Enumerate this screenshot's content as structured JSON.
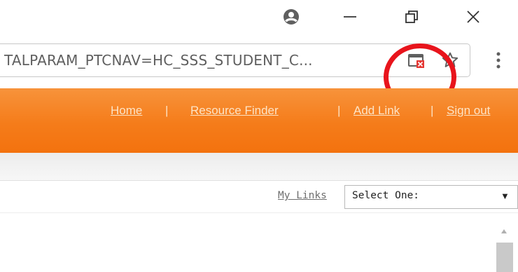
{
  "window": {
    "profile_icon": "account-circle-icon",
    "minimize_icon": "minimize-icon",
    "restore_icon": "restore-icon",
    "close_icon": "close-icon"
  },
  "address_bar": {
    "url": "TALPARAM_PTCNAV=HC_SSS_STUDENT_C...",
    "popup_icon": "popup-blocked-icon",
    "star_icon": "bookmark-star-icon",
    "menu_icon": "more-vert-icon"
  },
  "header": {
    "links": [
      "Home",
      "Resource Finder",
      "Add Link",
      "Sign out"
    ],
    "separator": "|"
  },
  "my_links": {
    "label": "My Links",
    "select_value": "Select One:"
  },
  "colors": {
    "header_orange": "#f57c1a",
    "annotation_red": "#e8141c",
    "link_color": "#fde4c6"
  }
}
